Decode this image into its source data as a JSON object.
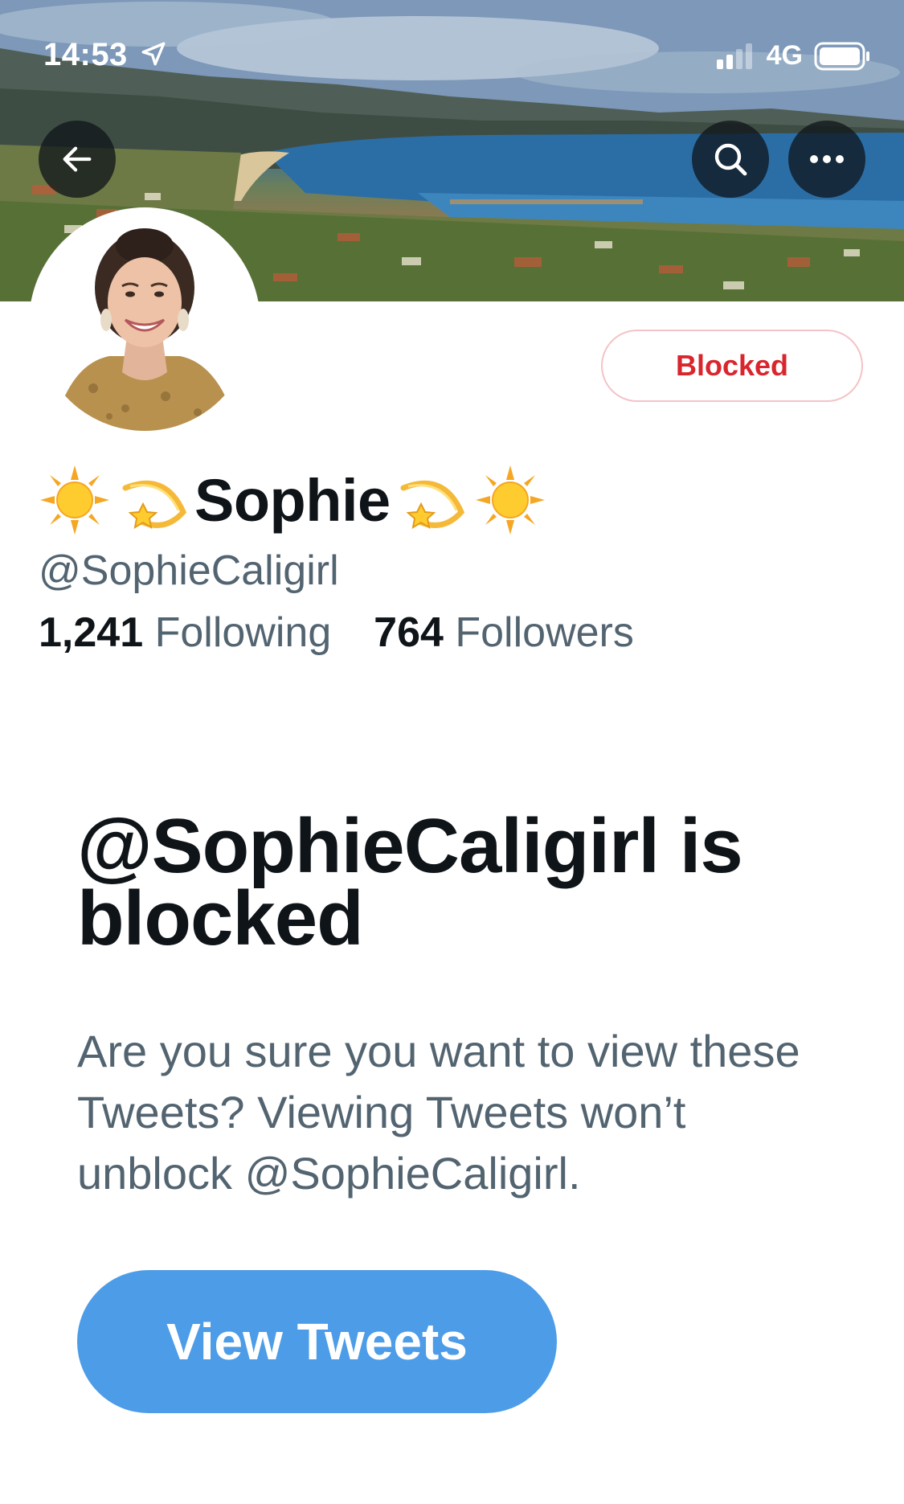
{
  "status_bar": {
    "time": "14:53",
    "network": "4G"
  },
  "profile": {
    "display_name": "Sophie",
    "name_emoji_left": [
      "sun-emoji",
      "dizzy-emoji"
    ],
    "name_emoji_right": [
      "dizzy-emoji",
      "sun-emoji"
    ],
    "handle": "@SophieCaligirl",
    "following_count": "1,241",
    "following_label": "Following",
    "followers_count": "764",
    "followers_label": "Followers"
  },
  "actions": {
    "blocked_label": "Blocked",
    "back_icon": "back-arrow-icon",
    "search_icon": "search-icon",
    "more_icon": "more-icon"
  },
  "block_notice": {
    "title": "@SophieCaligirl is blocked",
    "body": "Are you sure you want to view these Tweets? Viewing Tweets won’t unblock @SophieCaligirl.",
    "button_label": "View Tweets"
  },
  "colors": {
    "blocked_red": "#d9262e",
    "primary_blue": "#4c9ce8",
    "text_primary": "#0f1419",
    "text_secondary": "#536471"
  }
}
